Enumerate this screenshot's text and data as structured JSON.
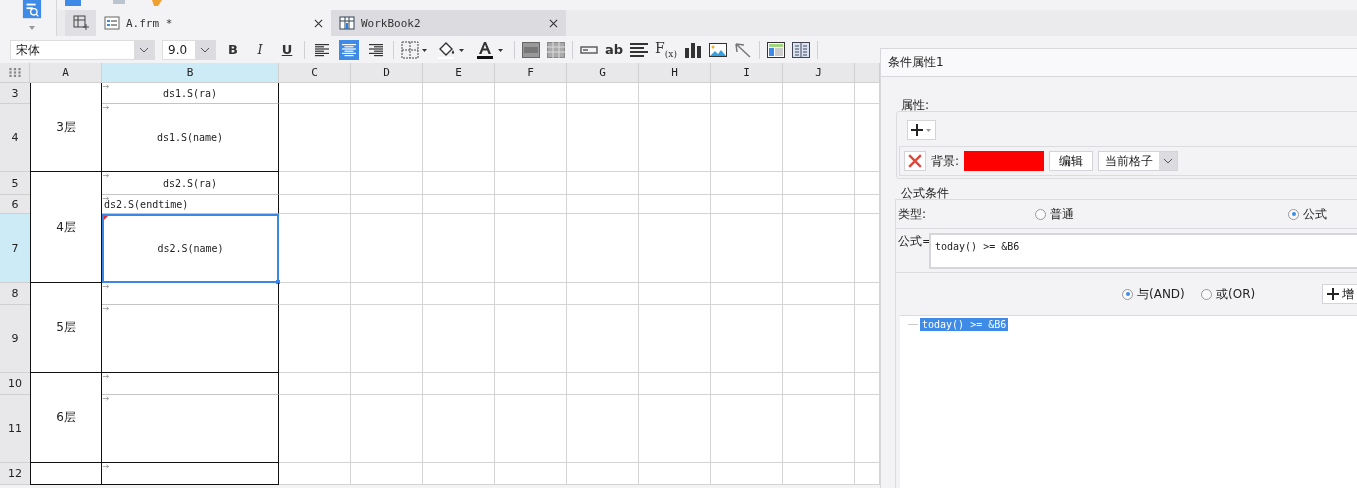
{
  "tabs": [
    {
      "label": "A.frm *",
      "selected": true
    },
    {
      "label": "WorkBook2",
      "selected": false
    }
  ],
  "format_toolbar": {
    "font": "宋体",
    "size": "9.0",
    "styles": [
      {
        "kind": "bold",
        "label": "B"
      },
      {
        "kind": "italic",
        "label": "I"
      },
      {
        "kind": "underline",
        "label": "U"
      }
    ],
    "alignment": [
      {
        "kind": "left",
        "selected": false
      },
      {
        "kind": "center",
        "selected": true
      },
      {
        "kind": "right",
        "selected": false
      }
    ],
    "text_tool": "ab",
    "formula_tool": "F$_{(x)}$"
  },
  "sheet": {
    "columns": [
      {
        "label": "A",
        "selected": false
      },
      {
        "label": "B",
        "selected": true
      },
      {
        "label": "C",
        "selected": false
      },
      {
        "label": "D",
        "selected": false
      },
      {
        "label": "E",
        "selected": false
      },
      {
        "label": "F",
        "selected": false
      },
      {
        "label": "G",
        "selected": false
      },
      {
        "label": "H",
        "selected": false
      },
      {
        "label": "I",
        "selected": false
      },
      {
        "label": "J",
        "selected": false
      }
    ],
    "floors": [
      {
        "label": "3层",
        "rows": [
          {
            "number": "3",
            "selected": false,
            "cell_b": {
              "text": "ds1.S(ra)",
              "left_aligned": false,
              "condition": false
            }
          },
          {
            "number": "4",
            "selected": false,
            "cell_b": {
              "text": "ds1.S(name)",
              "left_aligned": false,
              "condition": false
            }
          }
        ]
      },
      {
        "label": "4层",
        "rows": [
          {
            "number": "5",
            "selected": false,
            "cell_b": {
              "text": "ds2.S(ra)",
              "left_aligned": false,
              "condition": false
            }
          },
          {
            "number": "6",
            "selected": false,
            "cell_b": {
              "text": "ds2.S(endtime)",
              "left_aligned": true,
              "condition": false
            }
          },
          {
            "number": "7",
            "selected": true,
            "cell_b": {
              "text": "ds2.S(name)",
              "left_aligned": false,
              "condition": true
            }
          }
        ]
      },
      {
        "label": "5层",
        "rows": [
          {
            "number": "8",
            "selected": false,
            "cell_b": {
              "condition": false
            }
          },
          {
            "number": "9",
            "selected": false,
            "cell_b": {
              "condition": false
            }
          }
        ]
      },
      {
        "label": "6层",
        "rows": [
          {
            "number": "10",
            "selected": false,
            "cell_b": {
              "condition": false
            }
          },
          {
            "number": "11",
            "selected": false,
            "cell_b": {
              "condition": false
            }
          }
        ]
      },
      {
        "rows": [
          {
            "number": "12",
            "selected": false,
            "cell_b": {
              "condition": false
            }
          }
        ]
      }
    ]
  },
  "panel": {
    "title": "条件属性1",
    "attributes": {
      "legend": "属性:",
      "items": [
        {
          "label": "背景:",
          "color": "#ff0000",
          "edit_button": "编辑",
          "scope": "当前格子"
        }
      ]
    },
    "formula_condition": {
      "legend": "公式条件",
      "type_label": "类型:",
      "types": [
        {
          "label": "普通",
          "selected": false
        },
        {
          "label": "公式",
          "selected": true
        }
      ],
      "formula_label": "公式=",
      "formula": "today() >= &B6",
      "joins": [
        {
          "label": "与(AND)",
          "selected": true
        },
        {
          "label": "或(OR)",
          "selected": false
        }
      ],
      "add_button": "增",
      "conditions": [
        {
          "text": "today() >= &B6",
          "selected": true
        }
      ]
    }
  }
}
